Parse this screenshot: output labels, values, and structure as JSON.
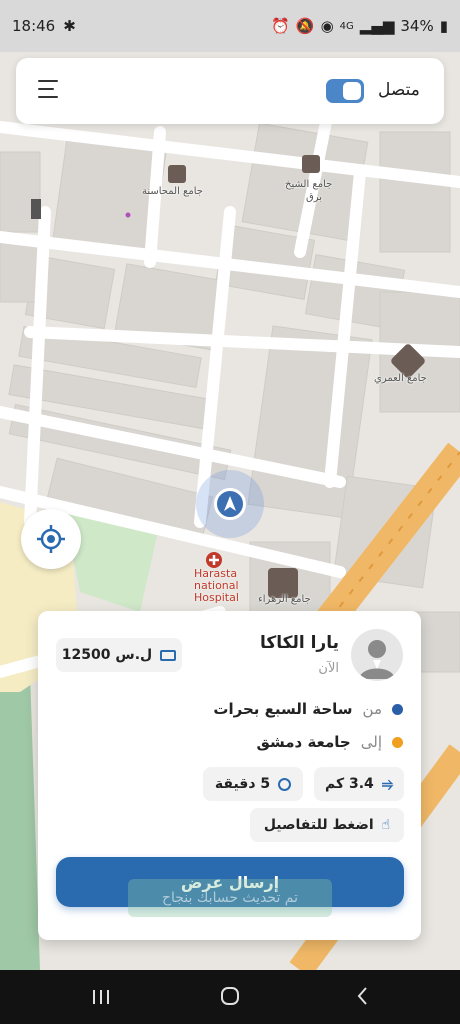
{
  "status_bar": {
    "time": "18:46",
    "battery": "34%",
    "network": "4G"
  },
  "header": {
    "online_label": "متصل",
    "online_on": true,
    "accent_color": "#4a86c8"
  },
  "map": {
    "labels": {
      "mosque_mahasna": "جامع المحاسنة",
      "mosque_sheikh_line1": "جامع الشيخ",
      "mosque_sheikh_line2": "برق",
      "mosque_omari": "جامع العمري",
      "mosque_zahraa": "جامع الزهراء",
      "hospital_line1": "Harasta",
      "hospital_line2": "national",
      "hospital_line3": "Hospital"
    }
  },
  "offer": {
    "rider_name": "يارا الكاكا",
    "time_ago": "الآن",
    "price": "12500 ل.س",
    "from_prefix": "من",
    "from_place": "ساحة السبع بحرات",
    "to_prefix": "إلى",
    "to_place": "جامعة دمشق",
    "distance": "3.4 كم",
    "duration": "5 دقيقة",
    "details_hint": "اضغط للتفاصيل",
    "send_button": "إرسال عرض",
    "toast": "تم تحديث حسابك بنجاح",
    "from_color": "#2a5fa8",
    "to_color": "#f0a020",
    "button_color": "#2a6bb0"
  }
}
